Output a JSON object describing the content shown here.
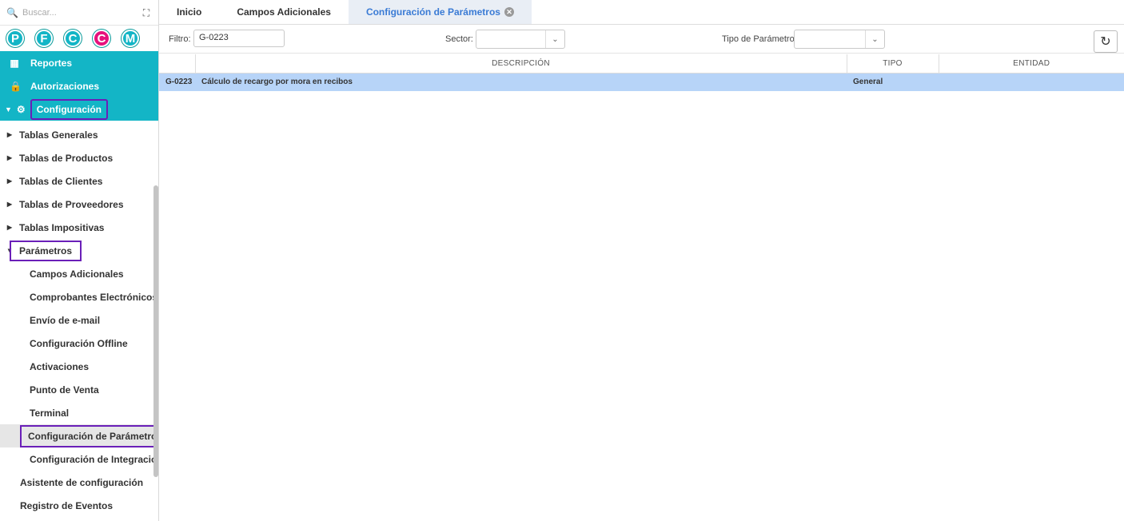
{
  "search": {
    "placeholder": "Buscar..."
  },
  "avatars": [
    {
      "letter": "P",
      "color": "#13b5c6"
    },
    {
      "letter": "F",
      "color": "#13b5c6"
    },
    {
      "letter": "C",
      "color": "#13b5c6"
    },
    {
      "letter": "C",
      "color": "#e6127d"
    },
    {
      "letter": "M",
      "color": "#13b5c6"
    }
  ],
  "sidebar": {
    "top_items": [
      "Reportes",
      "Autorizaciones",
      "Configuración"
    ],
    "items": [
      "Tablas Generales",
      "Tablas de Productos",
      "Tablas de Clientes",
      "Tablas de Proveedores",
      "Tablas Impositivas",
      "Parámetros",
      "Campos Adicionales",
      "Comprobantes Electrónicos",
      "Envío de e-mail",
      "Configuración Offline",
      "Activaciones",
      "Punto de Venta",
      "Terminal",
      "Configuración de Parámetros",
      "Configuración de Integracione",
      "Asistente de configuración",
      "Registro de Eventos"
    ]
  },
  "tabs": [
    "Inicio",
    "Campos Adicionales",
    "Configuración de Parámetros"
  ],
  "filters": {
    "filtro_label": "Filtro:",
    "filtro_value": "G-0223",
    "sector_label": "Sector:",
    "tipo_label": "Tipo de Parámetro:"
  },
  "grid": {
    "columns": [
      "DESCRIPCIÓN",
      "TIPO",
      "ENTIDAD"
    ],
    "rows": [
      {
        "code": "G-0223",
        "descripcion": "Cálculo de recargo por mora en recibos",
        "tipo": "General",
        "entidad": ""
      }
    ]
  }
}
